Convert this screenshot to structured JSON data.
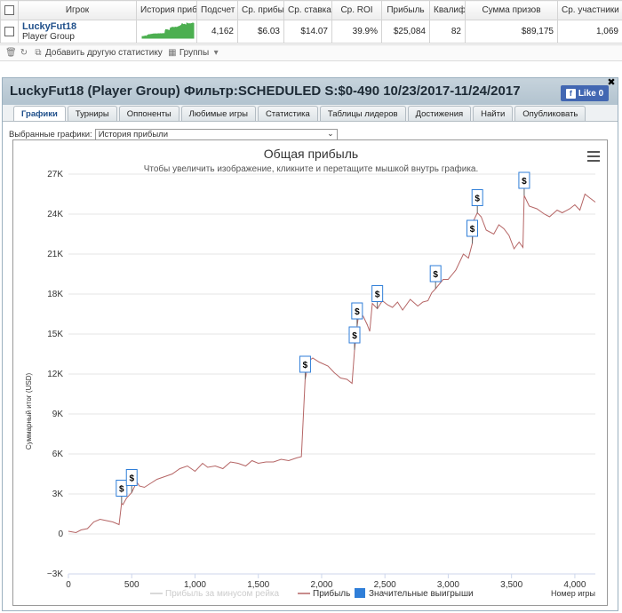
{
  "stats_table": {
    "headers": [
      "Игрок",
      "История прибыли",
      "Подсчет",
      "Ср. прибыль",
      "Ср. ставка",
      "Ср. ROI",
      "Прибыль",
      "Квалиф",
      "Сумма призов",
      "Ср. участники"
    ],
    "row": {
      "player_name": "LuckyFut18",
      "player_group": "Player Group",
      "count": "4,162",
      "avg_profit": "$6.03",
      "avg_stake": "$14.07",
      "avg_roi": "39.9%",
      "profit": "$25,084",
      "qualif": "82",
      "prize_sum": "$89,175",
      "avg_entrants": "1,069"
    }
  },
  "toolbar": {
    "add_stat_label": "Добавить другую статистику",
    "groups_label": "Группы",
    "icons": [
      "trash-icon",
      "refresh-icon",
      "add-stat-icon",
      "groups-icon",
      "dropdown-icon"
    ]
  },
  "panel": {
    "title": "LuckyFut18 (Player Group) Фильтр:SCHEDULED S:$0-490 10/23/2017-11/24/2017",
    "close_symbol": "✖",
    "like_label": "Like 0",
    "tabs": [
      "Графики",
      "Турниры",
      "Оппоненты",
      "Любимые игры",
      "Статистика",
      "Таблицы лидеров",
      "Достижения",
      "Найти",
      "Опубликовать"
    ],
    "active_tab": 0,
    "select_label": "Выбранные графики:",
    "select_value": "История прибыли"
  },
  "colors": {
    "profit_line": "#b56565",
    "sparkline": "#4caf50",
    "like_bg": "#4267b2",
    "legend_marker_big_wins": "#2f7ed8",
    "legend_inactive": "#cccccc"
  },
  "chart_data": {
    "type": "line",
    "title": "Общая прибыль",
    "subtitle": "Чтобы увеличить изображение, кликните и перетащите мышкой внутрь графика.",
    "ylabel": "Суммарный итог (USD)",
    "xlabel": "Номер игры",
    "xlim": [
      0,
      4162
    ],
    "ylim": [
      -3000,
      27000
    ],
    "x_ticks": [
      "0",
      "500",
      "1,000",
      "1,500",
      "2,000",
      "2,500",
      "3,000",
      "3,500",
      "4,000"
    ],
    "y_ticks": [
      "−3K",
      "0",
      "3K",
      "6K",
      "9K",
      "12K",
      "15K",
      "18K",
      "21K",
      "24K",
      "27K"
    ],
    "grid": true,
    "legend_placement": "bottom",
    "legend": [
      "Прибыль за минусом рейка",
      "Прибыль",
      "Значительные выигрыши"
    ],
    "series": [
      {
        "name": "Прибыль",
        "x": [
          0,
          60,
          100,
          150,
          200,
          250,
          300,
          350,
          400,
          420,
          430,
          460,
          500,
          540,
          560,
          600,
          650,
          700,
          760,
          820,
          880,
          940,
          1000,
          1060,
          1100,
          1160,
          1220,
          1280,
          1340,
          1400,
          1450,
          1500,
          1560,
          1620,
          1680,
          1740,
          1800,
          1840,
          1870,
          1900,
          1930,
          1980,
          2050,
          2100,
          2150,
          2200,
          2240,
          2260,
          2280,
          2290,
          2300,
          2330,
          2360,
          2380,
          2400,
          2420,
          2440,
          2480,
          2520,
          2560,
          2600,
          2640,
          2700,
          2760,
          2800,
          2840,
          2870,
          2900,
          2960,
          3000,
          3060,
          3120,
          3160,
          3190,
          3200,
          3230,
          3260,
          3300,
          3360,
          3400,
          3440,
          3480,
          3520,
          3560,
          3590,
          3600,
          3640,
          3700,
          3760,
          3800,
          3860,
          3900,
          3960,
          4000,
          4040,
          4080,
          4120,
          4162
        ],
        "y": [
          200,
          100,
          300,
          400,
          900,
          1100,
          1000,
          900,
          700,
          2300,
          2200,
          2700,
          3100,
          3900,
          3600,
          3500,
          3800,
          4100,
          4300,
          4500,
          4900,
          5100,
          4700,
          5300,
          5000,
          5100,
          4900,
          5400,
          5300,
          5100,
          5500,
          5300,
          5400,
          5400,
          5600,
          5500,
          5700,
          5800,
          11600,
          13000,
          13200,
          12900,
          12600,
          12100,
          11700,
          11600,
          11300,
          13800,
          15600,
          16300,
          16700,
          16300,
          15700,
          15200,
          17300,
          17100,
          16900,
          17500,
          17200,
          17000,
          17400,
          16800,
          17600,
          17100,
          17400,
          17500,
          18100,
          18400,
          19100,
          19100,
          19800,
          21000,
          20700,
          21800,
          23500,
          24100,
          23800,
          22800,
          22500,
          23200,
          22900,
          22400,
          21400,
          21900,
          21500,
          25400,
          24600,
          24400,
          24000,
          23800,
          24300,
          24100,
          24400,
          24700,
          24300,
          25500,
          25200,
          24900
        ]
      }
    ],
    "big_wins": [
      {
        "x": 420,
        "y": 2300
      },
      {
        "x": 500,
        "y": 3100
      },
      {
        "x": 1870,
        "y": 11600
      },
      {
        "x": 2260,
        "y": 13800
      },
      {
        "x": 2280,
        "y": 15600
      },
      {
        "x": 2440,
        "y": 16900
      },
      {
        "x": 2900,
        "y": 18400
      },
      {
        "x": 3190,
        "y": 21800
      },
      {
        "x": 3230,
        "y": 24100
      },
      {
        "x": 3600,
        "y": 25400
      }
    ],
    "big_win_label": "$"
  }
}
